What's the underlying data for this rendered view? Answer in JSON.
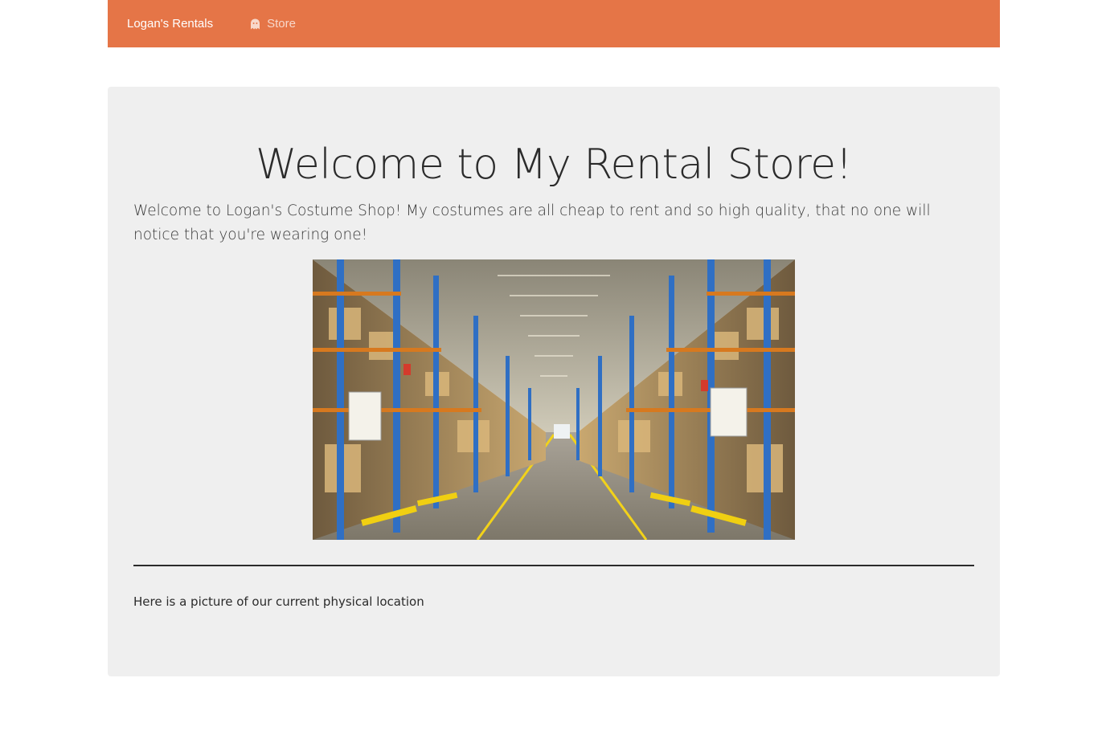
{
  "navbar": {
    "brand": "Logan's Rentals",
    "links": [
      {
        "label": "Store",
        "icon": "ghost-icon"
      }
    ],
    "background_color": "#e57547"
  },
  "jumbotron": {
    "title": "Welcome to My Rental Store!",
    "lead": "Welcome to Logan's Costume Shop! My costumes are all cheap to rent and so high quality, that no one will notice that you're wearing one!",
    "caption": "Here is a picture of our current physical location",
    "background_color": "#efefef"
  }
}
